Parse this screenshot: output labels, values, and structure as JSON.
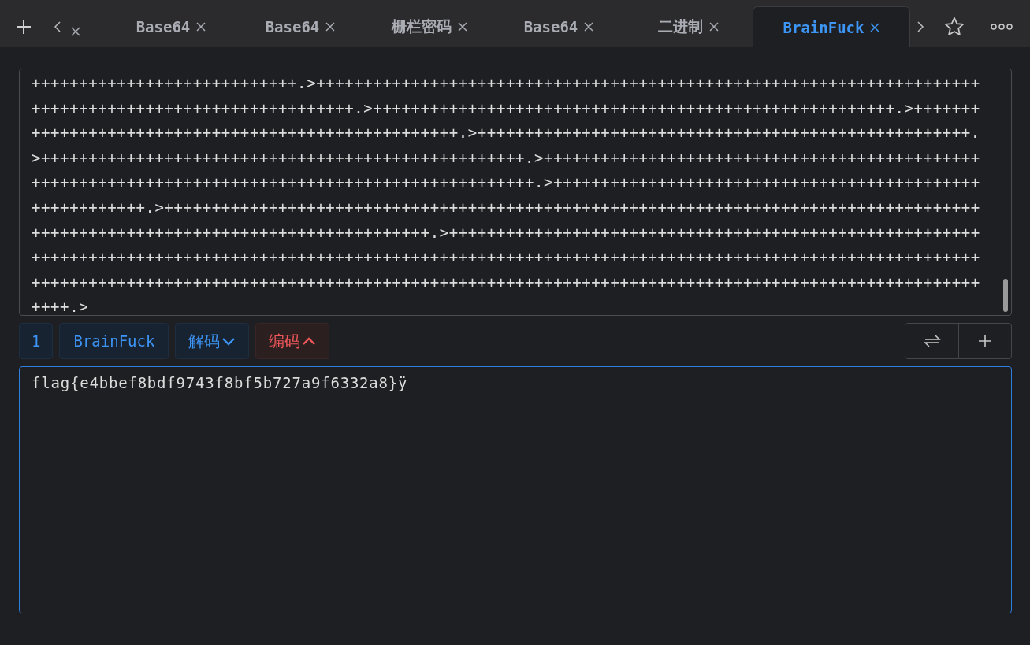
{
  "tabs": [
    {
      "selected": false
    },
    {
      "label": "Base64",
      "selected": false
    },
    {
      "label": "Base64",
      "selected": false
    },
    {
      "label": "栅栏密码",
      "selected": false
    },
    {
      "label": "Base64",
      "selected": false
    },
    {
      "label": "二进制",
      "selected": false
    },
    {
      "label": "BrainFuck",
      "selected": true
    }
  ],
  "input": {
    "lines": [
      "++++++++++++++++++++++++++++.>++++++++++++++++++++++++++++++++++++++++++++++++++++++++++++++++++++++",
      "++++++++++++++++++++++++++++++++++.>+++++++++++++++++++++++++++++++++++++++++++++++++++++++.>+++++++",
      "+++++++++++++++++++++++++++++++++++++++++++++.>++++++++++++++++++++++++++++++++++++++++++++++++++++.",
      ">+++++++++++++++++++++++++++++++++++++++++++++++++++.>++++++++++++++++++++++++++++++++++++++++++++++",
      "+++++++++++++++++++++++++++++++++++++++++++++++++++++.>+++++++++++++++++++++++++++++++++++++++++++++",
      "++++++++++++.>++++++++++++++++++++++++++++++++++++++++++++++++++++++++++++++++++++++++++++++++++++++",
      "++++++++++++++++++++++++++++++++++++++++++.>++++++++++++++++++++++++++++++++++++++++++++++++++++++++",
      "++++++++++++++++++++++++++++++++++++++++++++++++++++++++++++++++++++++++++++++++++++++++++++++++++++",
      "++++++++++++++++++++++++++++++++++++++++++++++++++++++++++++++++++++++++++++++++++++++++++++++++++++",
      "++++.>"
    ]
  },
  "toolbar": {
    "step": "1",
    "method": "BrainFuck",
    "actions": [
      {
        "label": "解码",
        "kind": "decode"
      },
      {
        "label": "编码",
        "kind": "encode"
      }
    ]
  },
  "output": {
    "value": "flag{e4bbef8bdf9743f8bf5b727a9f6332a8}ÿ"
  }
}
